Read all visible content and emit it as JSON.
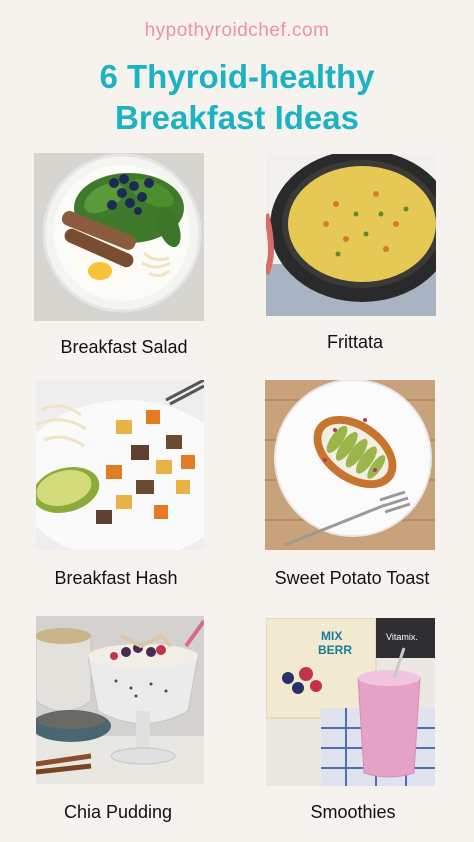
{
  "site": "hypothyroidchef.com",
  "title_line1": "6 Thyroid-healthy",
  "title_line2": "Breakfast Ideas",
  "items": [
    {
      "label": "Breakfast Salad"
    },
    {
      "label": "Frittata"
    },
    {
      "label": "Breakfast Hash"
    },
    {
      "label": "Sweet Potato Toast"
    },
    {
      "label": "Chia Pudding"
    },
    {
      "label": "Smoothies"
    }
  ],
  "colors": {
    "background": "#f6f3ee",
    "site": "#f08fa8",
    "title": "#1bb3c4"
  },
  "package_text": {
    "mix": "MIX",
    "berry": "BERR",
    "brand": "Vitamix."
  }
}
